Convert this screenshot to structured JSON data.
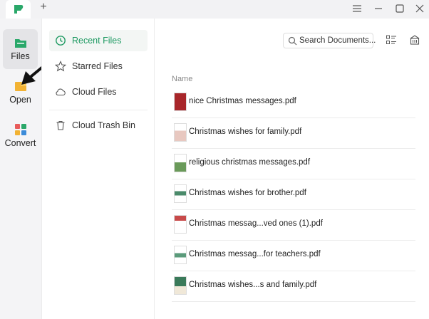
{
  "titlebar": {
    "new_tab_icon": "plus-icon",
    "controls": [
      "menu-icon",
      "minimize-icon",
      "maximize-icon",
      "close-icon"
    ]
  },
  "leftnav": {
    "items": [
      {
        "label": "Files",
        "icon": "files-icon",
        "color": "#2aa86a",
        "active": true
      },
      {
        "label": "Open",
        "icon": "open-folder-icon",
        "color": "#f2b233",
        "active": false
      },
      {
        "label": "Convert",
        "icon": "convert-grid-icon",
        "color": "#e85b5b",
        "active": false
      }
    ]
  },
  "sidebar": {
    "items": [
      {
        "label": "Recent Files",
        "icon": "clock-icon",
        "active": true
      },
      {
        "label": "Starred Files",
        "icon": "star-icon",
        "active": false
      },
      {
        "label": "Cloud Files",
        "icon": "cloud-icon",
        "active": false
      },
      {
        "label": "Cloud Trash Bin",
        "icon": "trash-icon",
        "active": false
      }
    ]
  },
  "main": {
    "search": {
      "placeholder": "Search Documents..."
    },
    "column_header": "Name",
    "files": [
      {
        "name": "nice Christmas messages.pdf",
        "thumb": "#a8262a"
      },
      {
        "name": "Christmas wishes for family.pdf",
        "thumb": "#e8c8c0"
      },
      {
        "name": "religious christmas messages.pdf",
        "thumb": "#6a9a5a"
      },
      {
        "name": "Christmas wishes for brother.pdf",
        "thumb": "#4a8a6a"
      },
      {
        "name": "Christmas messag...ved ones (1).pdf",
        "thumb": "#c84a4a"
      },
      {
        "name": "Christmas messag...for teachers.pdf",
        "thumb": "#5a9a7a"
      },
      {
        "name": "Christmas wishes...s and family.pdf",
        "thumb": "#3a7a5a"
      }
    ]
  },
  "colors": {
    "accent": "#1e9a62"
  }
}
